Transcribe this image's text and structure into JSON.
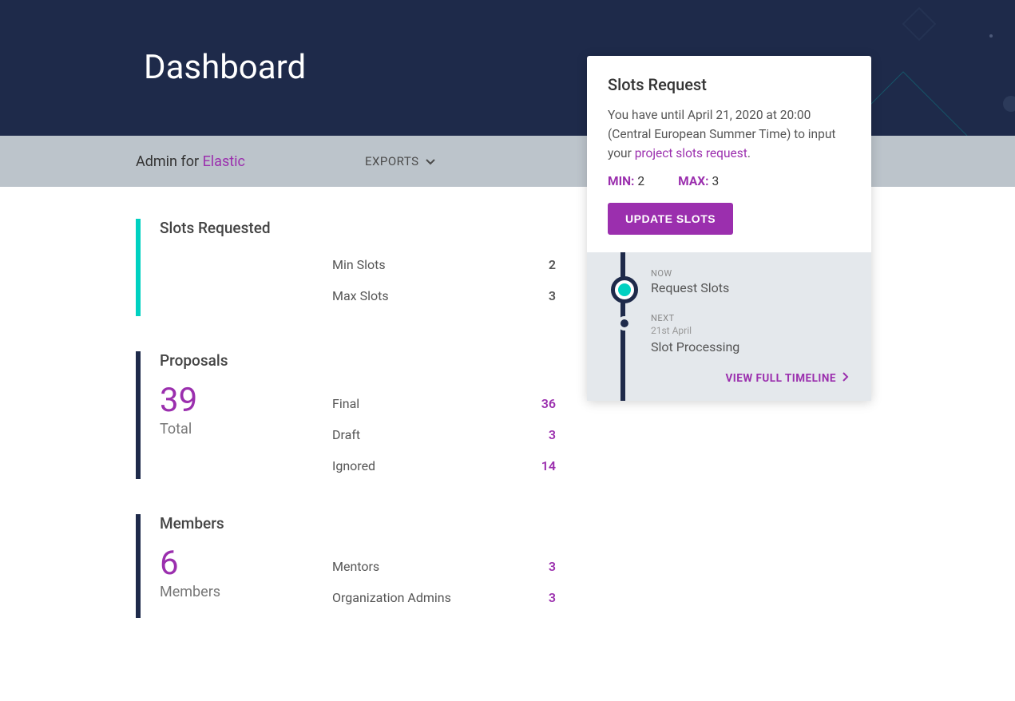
{
  "hero": {
    "title": "Dashboard"
  },
  "subheader": {
    "admin_for_prefix": "Admin for ",
    "org_name": "Elastic",
    "exports_label": "EXPORTS"
  },
  "slots_section": {
    "title": "Slots Requested",
    "rows": [
      {
        "label": "Min Slots",
        "value": "2"
      },
      {
        "label": "Max Slots",
        "value": "3"
      }
    ]
  },
  "proposals_section": {
    "title": "Proposals",
    "total_value": "39",
    "total_label": "Total",
    "rows": [
      {
        "label": "Final",
        "value": "36"
      },
      {
        "label": "Draft",
        "value": "3"
      },
      {
        "label": "Ignored",
        "value": "14"
      }
    ]
  },
  "members_section": {
    "title": "Members",
    "total_value": "6",
    "total_label": "Members",
    "rows": [
      {
        "label": "Mentors",
        "value": "3"
      },
      {
        "label": "Organization Admins",
        "value": "3"
      }
    ]
  },
  "card": {
    "title": "Slots Request",
    "desc_prefix": "You have until April 21, 2020 at 20:00 (Central European Summer Time) to input your ",
    "desc_link": "project slots request",
    "desc_suffix": ".",
    "min_label": "MIN:",
    "min_value": "2",
    "max_label": "MAX:",
    "max_value": "3",
    "update_button": "UPDATE SLOTS",
    "timeline": {
      "now_tag": "NOW",
      "now_label": "Request Slots",
      "next_tag": "NEXT",
      "next_date": "21st April",
      "next_label": "Slot Processing",
      "view_full": "VIEW FULL TIMELINE"
    }
  }
}
